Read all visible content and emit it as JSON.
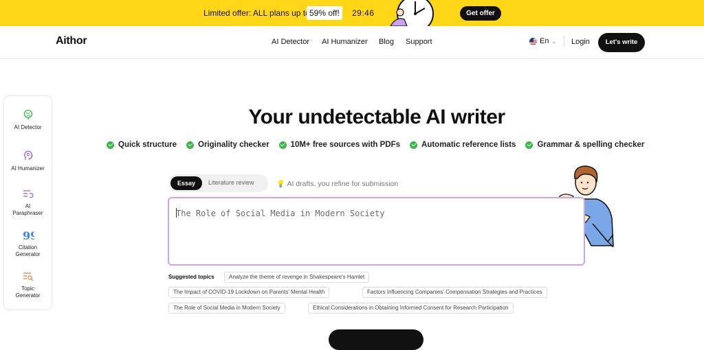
{
  "promo": {
    "text": "Limited offer: ALL plans up to",
    "percent": "59% off!",
    "timer": "29:46",
    "button": "Get offer"
  },
  "header": {
    "logo": "Aithor",
    "nav": [
      "AI Detector",
      "AI Humanizer",
      "Blog",
      "Support"
    ],
    "lang": "En",
    "login": "Login",
    "cta": "Let's write"
  },
  "sidebar": {
    "items": [
      {
        "label": "AI Detector",
        "icon": "globe-search-icon"
      },
      {
        "label": "AI Humanizer",
        "icon": "head-icon"
      },
      {
        "label": "AI Paraphraser",
        "icon": "paraphrase-icon"
      },
      {
        "label": "Citation Generator",
        "icon": "quote-icon"
      },
      {
        "label": "Topic Generator",
        "icon": "topic-search-icon"
      }
    ]
  },
  "main": {
    "title": "Your undetectable AI writer",
    "features": [
      "Quick structure",
      "Originality checker",
      "10M+ free sources with PDFs",
      "Automatic reference lists",
      "Grammar & spelling checker"
    ],
    "tabs": {
      "essay": "Essay",
      "literature": "Literature review"
    },
    "hint": "AI drafts, you refine for submission",
    "input_value": "The Role of Social Media in Modern Society",
    "suggested_label": "Suggested topics",
    "suggested": [
      "Analyze the theme of revenge in Shakespeare's Hamlet",
      "The Impact of COVID-19 Lockdown on Parents' Mental Health",
      "Factors Influencing Companies' Compensation Strategies and Practices",
      "The Role of Social Media in Modern Society",
      "Ethical Considerations in Obtaining Informed Consent for Research Participation"
    ]
  },
  "colors": {
    "banner": "#ffd618",
    "accent_border": "#c9a3f0",
    "check_green": "#3bb54a",
    "dark": "#111111"
  }
}
